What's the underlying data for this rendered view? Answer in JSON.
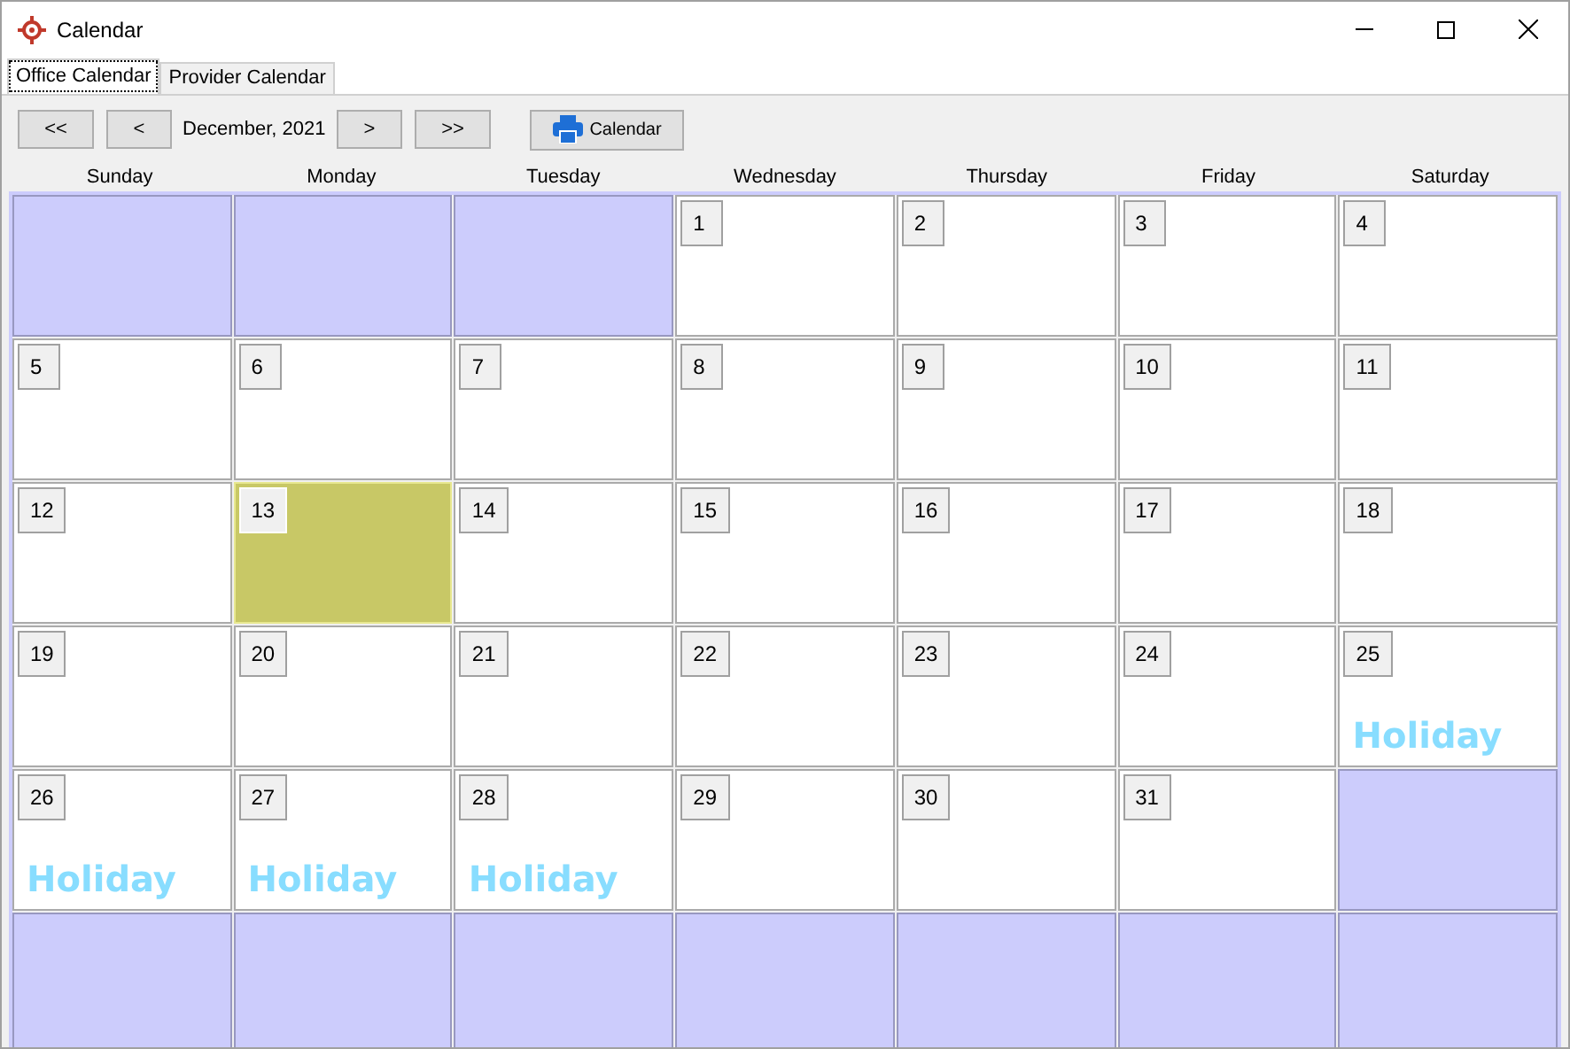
{
  "window": {
    "title": "Calendar"
  },
  "tabs": [
    {
      "label": "Office Calendar",
      "selected": true
    },
    {
      "label": "Provider Calendar",
      "selected": false
    }
  ],
  "toolbar": {
    "first": "<<",
    "prev": "<",
    "month": "December, 2021",
    "next": ">",
    "last": ">>",
    "print": "Calendar"
  },
  "weekdays": [
    "Sunday",
    "Monday",
    "Tuesday",
    "Wednesday",
    "Thursday",
    "Friday",
    "Saturday"
  ],
  "weeks": [
    [
      {
        "kind": "blank"
      },
      {
        "kind": "blank"
      },
      {
        "kind": "blank"
      },
      {
        "kind": "day",
        "day": "1",
        "selected": false
      },
      {
        "kind": "day",
        "day": "2",
        "selected": false
      },
      {
        "kind": "day",
        "day": "3",
        "selected": false
      },
      {
        "kind": "day",
        "day": "4",
        "selected": false
      }
    ],
    [
      {
        "kind": "day",
        "day": "5",
        "selected": false
      },
      {
        "kind": "day",
        "day": "6",
        "selected": false
      },
      {
        "kind": "day",
        "day": "7",
        "selected": false
      },
      {
        "kind": "day",
        "day": "8",
        "selected": false
      },
      {
        "kind": "day",
        "day": "9",
        "selected": false
      },
      {
        "kind": "day",
        "day": "10",
        "selected": false
      },
      {
        "kind": "day",
        "day": "11",
        "selected": false
      }
    ],
    [
      {
        "kind": "day",
        "day": "12",
        "selected": false
      },
      {
        "kind": "day",
        "day": "13",
        "selected": true
      },
      {
        "kind": "day",
        "day": "14",
        "selected": false
      },
      {
        "kind": "day",
        "day": "15",
        "selected": false
      },
      {
        "kind": "day",
        "day": "16",
        "selected": false
      },
      {
        "kind": "day",
        "day": "17",
        "selected": false
      },
      {
        "kind": "day",
        "day": "18",
        "selected": false
      }
    ],
    [
      {
        "kind": "day",
        "day": "19",
        "selected": false
      },
      {
        "kind": "day",
        "day": "20",
        "selected": false
      },
      {
        "kind": "day",
        "day": "21",
        "selected": false
      },
      {
        "kind": "day",
        "day": "22",
        "selected": false
      },
      {
        "kind": "day",
        "day": "23",
        "selected": false
      },
      {
        "kind": "day",
        "day": "24",
        "selected": false
      },
      {
        "kind": "day",
        "day": "25",
        "selected": false,
        "note": "Holiday"
      }
    ],
    [
      {
        "kind": "day",
        "day": "26",
        "selected": false,
        "note": "Holiday"
      },
      {
        "kind": "day",
        "day": "27",
        "selected": false,
        "note": "Holiday"
      },
      {
        "kind": "day",
        "day": "28",
        "selected": false,
        "note": "Holiday"
      },
      {
        "kind": "day",
        "day": "29",
        "selected": false
      },
      {
        "kind": "day",
        "day": "30",
        "selected": false
      },
      {
        "kind": "day",
        "day": "31",
        "selected": false
      },
      {
        "kind": "blank"
      }
    ],
    [
      {
        "kind": "blank"
      },
      {
        "kind": "blank"
      },
      {
        "kind": "blank"
      },
      {
        "kind": "blank"
      },
      {
        "kind": "blank"
      },
      {
        "kind": "blank"
      },
      {
        "kind": "blank"
      }
    ]
  ]
}
